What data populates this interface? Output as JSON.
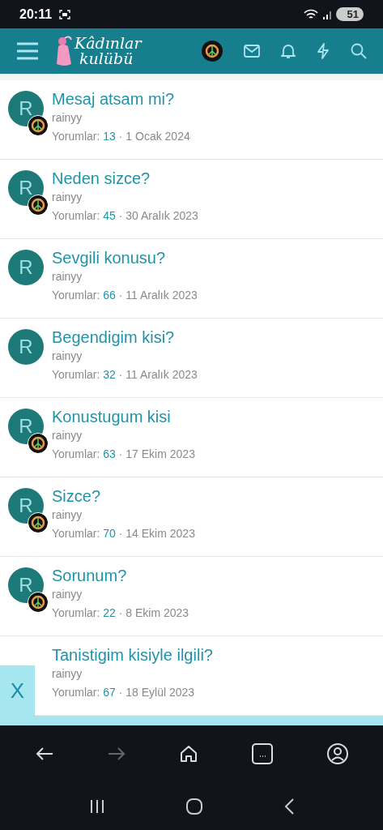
{
  "status_bar": {
    "time": "20:11",
    "battery": "51"
  },
  "header": {
    "logo_line_1": "Kâdınlar",
    "logo_line_2": "kulübü"
  },
  "threads": [
    {
      "title": "Mesaj atsam mi?",
      "author": "rainyy",
      "avatar_letter": "R",
      "badge": true,
      "comments_label": "Yorumlar:",
      "comments": "13",
      "date": "1 Ocak 2024"
    },
    {
      "title": "Neden sizce?",
      "author": "rainyy",
      "avatar_letter": "R",
      "badge": true,
      "comments_label": "Yorumlar:",
      "comments": "45",
      "date": "30 Aralık 2023"
    },
    {
      "title": "Sevgili konusu?",
      "author": "rainyy",
      "avatar_letter": "R",
      "badge": false,
      "comments_label": "Yorumlar:",
      "comments": "66",
      "date": "11 Aralık 2023"
    },
    {
      "title": "Begendigim kisi?",
      "author": "rainyy",
      "avatar_letter": "R",
      "badge": false,
      "comments_label": "Yorumlar:",
      "comments": "32",
      "date": "11 Aralık 2023"
    },
    {
      "title": "Konustugum kisi",
      "author": "rainyy",
      "avatar_letter": "R",
      "badge": true,
      "comments_label": "Yorumlar:",
      "comments": "63",
      "date": "17 Ekim 2023"
    },
    {
      "title": "Sizce?",
      "author": "rainyy",
      "avatar_letter": "R",
      "badge": true,
      "comments_label": "Yorumlar:",
      "comments": "70",
      "date": "14 Ekim 2023"
    },
    {
      "title": "Sorunum?",
      "author": "rainyy",
      "avatar_letter": "R",
      "badge": true,
      "comments_label": "Yorumlar:",
      "comments": "22",
      "date": "8 Ekim 2023"
    },
    {
      "title": "Tanistigim kisiyle ilgili?",
      "author": "rainyy",
      "comments_label": "Yorumlar:",
      "comments": "67",
      "date": "18 Eylül 2023"
    }
  ],
  "separator": "·",
  "close_tab": {
    "label": "X"
  },
  "browser_bar": {
    "forward_disabled": true
  }
}
